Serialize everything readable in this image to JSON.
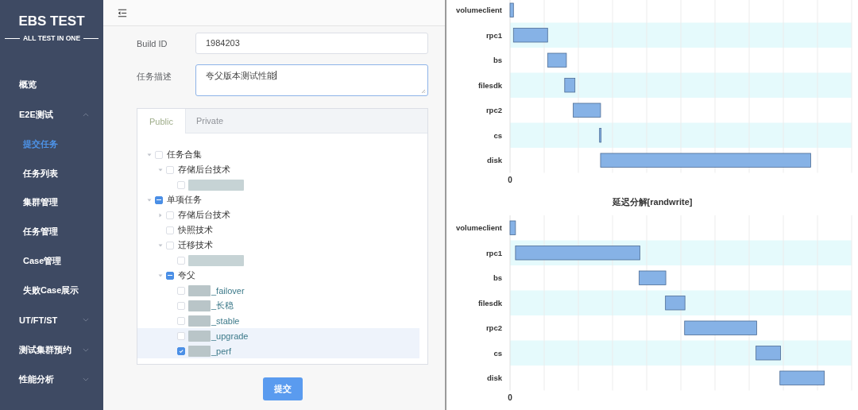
{
  "sidebar": {
    "logo": "EBS TEST",
    "tagline": "ALL TEST IN ONE",
    "items": [
      {
        "label": "概览",
        "selected": false
      },
      {
        "label": "E2E测试",
        "selected": false,
        "expanded": true,
        "children": [
          {
            "label": "提交任务",
            "selected": true
          },
          {
            "label": "任务列表",
            "selected": false
          },
          {
            "label": "集群管理",
            "selected": false
          },
          {
            "label": "任务管理",
            "selected": false
          },
          {
            "label": "Case管理",
            "selected": false
          },
          {
            "label": "失败Case展示",
            "selected": false
          }
        ]
      },
      {
        "label": "UT/FT/ST",
        "selected": false,
        "expanded": false
      },
      {
        "label": "测试集群预约",
        "selected": false,
        "expanded": false
      },
      {
        "label": "性能分析",
        "selected": false,
        "expanded": false
      }
    ]
  },
  "form": {
    "build_id": {
      "label": "Build ID",
      "value": "1984203"
    },
    "description": {
      "label": "任务描述",
      "value": "夸父版本测试性能"
    },
    "tabs": [
      {
        "label": "Public",
        "selected": true
      },
      {
        "label": "Private",
        "selected": false
      }
    ],
    "tree": [
      {
        "label": "任务合集",
        "expanded": true,
        "indeterminate": false,
        "highlighted": false,
        "children": [
          {
            "label": "存储后台技术",
            "expanded": true,
            "indeterminate": false,
            "highlighted": false,
            "children": [
              {
                "kind": "redacted",
                "checked": false,
                "highlighted": false
              }
            ]
          }
        ]
      },
      {
        "label": "单项任务",
        "expanded": true,
        "indeterminate": true,
        "highlighted": false,
        "children": [
          {
            "label": "存储后台技术",
            "expanded": false,
            "indeterminate": false,
            "highlighted": false
          },
          {
            "label": "快照技术",
            "checked": false,
            "highlighted": false
          },
          {
            "label": "迁移技术",
            "expanded": true,
            "indeterminate": false,
            "highlighted": false,
            "children": [
              {
                "kind": "redacted",
                "checked": false,
                "highlighted": false
              }
            ]
          },
          {
            "label": "夸父",
            "expanded": true,
            "indeterminate": true,
            "highlighted": false,
            "children": [
              {
                "kind": "suffix",
                "label": "_failover",
                "checked": false,
                "highlighted": false
              },
              {
                "kind": "suffix",
                "label": "_长稳",
                "checked": false,
                "highlighted": false
              },
              {
                "kind": "suffix",
                "label": "_stable",
                "checked": false,
                "highlighted": false
              },
              {
                "kind": "suffix",
                "label": "_upgrade",
                "checked": false,
                "highlighted": true
              },
              {
                "kind": "suffix",
                "label": "_perf",
                "checked": true,
                "highlighted": true
              }
            ]
          }
        ]
      }
    ],
    "submit": "提交"
  },
  "charts": [
    {
      "rows": [
        "volumeclient",
        "rpc1",
        "bs",
        "filesdk",
        "rpc2",
        "cs",
        "disk"
      ],
      "axis_labels": [
        "0"
      ]
    },
    {
      "title": "延迟分解[randwrite]",
      "rows": [
        "volumeclient",
        "rpc1",
        "bs",
        "filesdk",
        "rpc2",
        "cs",
        "disk"
      ],
      "axis_labels": [
        "0"
      ]
    }
  ]
}
